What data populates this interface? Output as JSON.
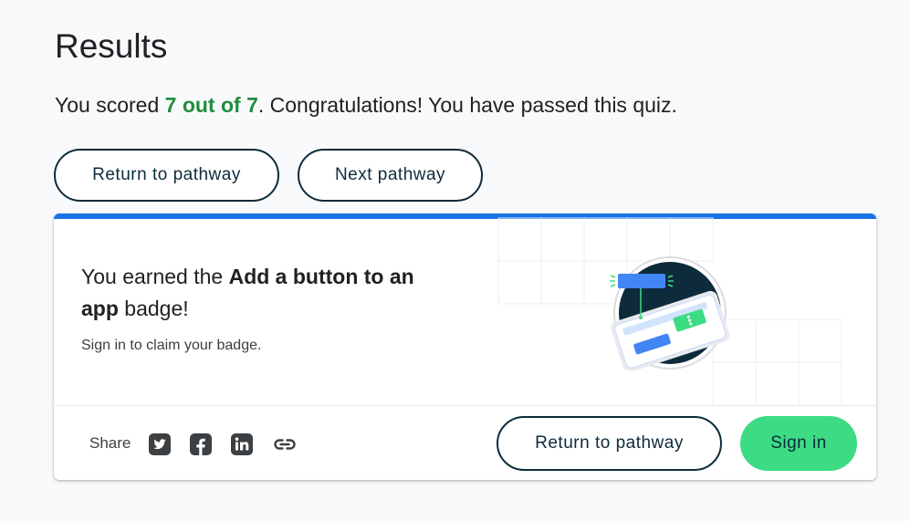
{
  "page": {
    "title": "Results",
    "score_prefix": "You scored ",
    "score": "7 out of 7",
    "score_suffix": ". Congratulations! You have passed this quiz.",
    "return_button": "Return to pathway",
    "next_button": "Next pathway"
  },
  "card": {
    "earned_prefix": "You earned the ",
    "badge_name": "Add a button to an app",
    "earned_suffix": " badge!",
    "claim_text": "Sign in to claim your badge.",
    "share_label": "Share",
    "share_icons": [
      "twitter-icon",
      "facebook-icon",
      "linkedin-icon",
      "link-icon"
    ],
    "return_button": "Return to pathway",
    "signin_button": "Sign in"
  },
  "colors": {
    "score_green": "#1e8e3e",
    "accent_blue": "#1a73e8",
    "signin_green": "#3ddc84",
    "dark_navy": "#0d2b3a"
  }
}
